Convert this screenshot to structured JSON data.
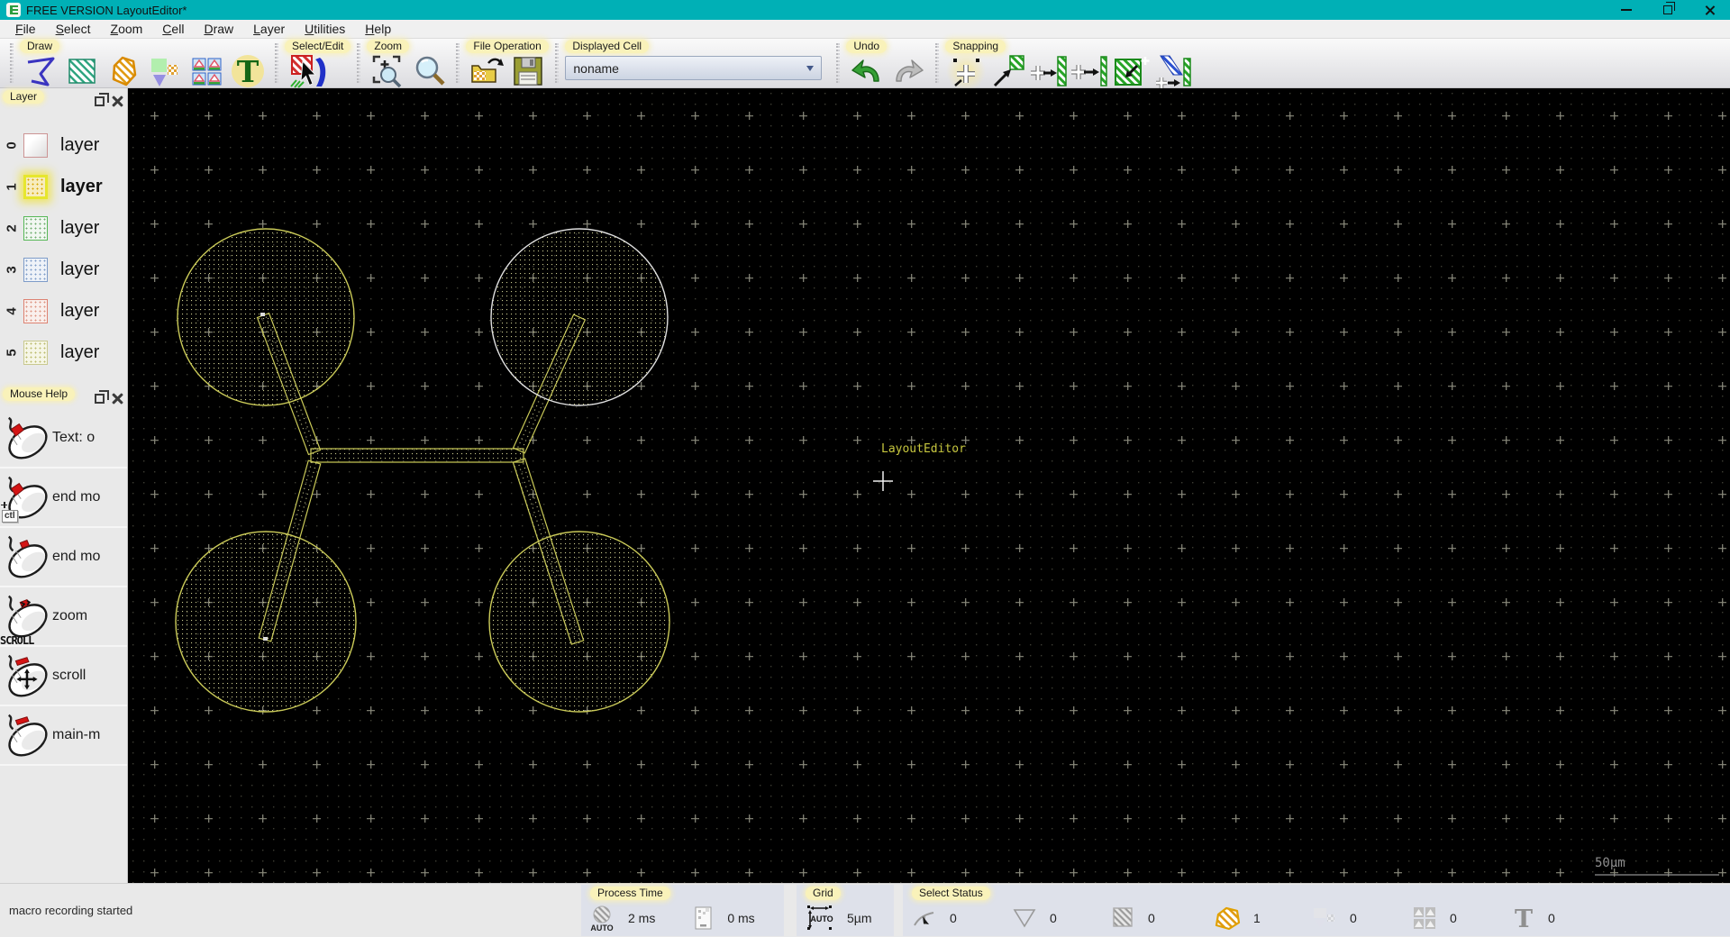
{
  "window": {
    "title": "FREE VERSION LayoutEditor*",
    "controls": [
      "minimize",
      "restore",
      "close"
    ]
  },
  "menu": {
    "items": [
      {
        "label": "File"
      },
      {
        "label": "Select"
      },
      {
        "label": "Zoom"
      },
      {
        "label": "Cell"
      },
      {
        "label": "Draw"
      },
      {
        "label": "Layer"
      },
      {
        "label": "Utilities"
      },
      {
        "label": "Help"
      }
    ]
  },
  "toolbar": {
    "draw": {
      "label": "Draw",
      "icons": [
        "polyline-tool",
        "box-tool",
        "polygon-tool",
        "cell-tool",
        "cell-array-tool",
        "text-tool"
      ]
    },
    "select_edit": {
      "label": "Select/Edit",
      "icons": [
        "select-mode"
      ]
    },
    "zoom": {
      "label": "Zoom",
      "icons": [
        "zoom-window",
        "magnifier"
      ]
    },
    "file_operation": {
      "label": "File Operation",
      "icons": [
        "open-file",
        "save-file"
      ]
    },
    "displayed_cell": {
      "label": "Displayed Cell",
      "value": "noname"
    },
    "undo": {
      "label": "Undo",
      "icons": [
        "undo",
        "redo"
      ]
    },
    "snapping": {
      "label": "Snapping",
      "icons": [
        "snap-grid",
        "snap-element",
        "snap-edge",
        "snap-line",
        "snap-area",
        "snap-diagonal"
      ],
      "active_index": 0
    }
  },
  "layer_panel": {
    "title": "Layer",
    "active_index": 1,
    "items": [
      {
        "index": "0",
        "label": "layer",
        "color": "#cc9494"
      },
      {
        "index": "1",
        "label": "layer",
        "color": "#d8a400"
      },
      {
        "index": "2",
        "label": "layer",
        "color": "#57b857"
      },
      {
        "index": "3",
        "label": "layer",
        "color": "#7e9cc8"
      },
      {
        "index": "4",
        "label": "layer",
        "color": "#dd8272"
      },
      {
        "index": "5",
        "label": "layer",
        "color": "#bcbc6e"
      }
    ]
  },
  "mouse_help": {
    "title": "Mouse Help",
    "items": [
      {
        "button": "left",
        "label": "Text: o",
        "modifier": ""
      },
      {
        "button": "left",
        "label": "end mo",
        "modifier": "ctl"
      },
      {
        "button": "middle",
        "label": "end mo",
        "modifier": ""
      },
      {
        "button": "wheel",
        "label": "zoom",
        "modifier": "SCROLL"
      },
      {
        "button": "drag",
        "label": "scroll",
        "modifier": ""
      },
      {
        "button": "top",
        "label": "main-m",
        "modifier": ""
      }
    ]
  },
  "canvas": {
    "cell_text_label": "LayoutEditor",
    "scale_label": "50µm",
    "design_color": "#caca58",
    "selected_outline_color": "#e0e0e0",
    "background": "#000000"
  },
  "statusbar": {
    "message": "macro recording started",
    "process_time": {
      "label": "Process Time",
      "values": [
        "2 ms",
        "0 ms"
      ],
      "icons": [
        "auto-process-icon",
        "design-doc-icon"
      ]
    },
    "grid": {
      "label": "Grid",
      "value": "5µm",
      "icon": "grid-auto-icon"
    },
    "select_status": {
      "label": "Select Status",
      "counters": [
        {
          "icon": "point",
          "value": "0"
        },
        {
          "icon": "path",
          "value": "0"
        },
        {
          "icon": "box",
          "value": "0"
        },
        {
          "icon": "polygon",
          "value": "1"
        },
        {
          "icon": "cell",
          "value": "0"
        },
        {
          "icon": "cell-array",
          "value": "0"
        },
        {
          "icon": "text",
          "value": "0"
        }
      ]
    }
  }
}
